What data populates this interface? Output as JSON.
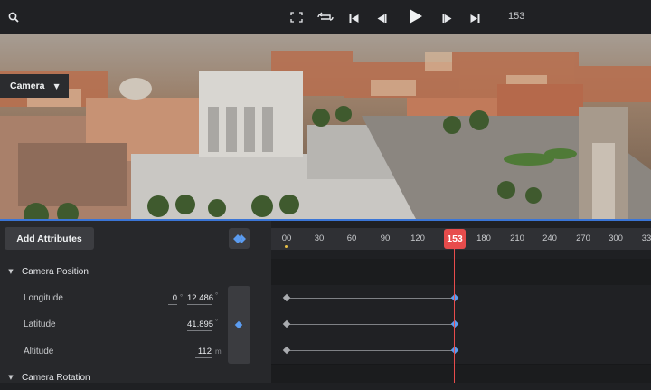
{
  "toolbar": {
    "search_icon": "search-icon",
    "fullscreen_icon": "fullscreen-icon",
    "loop_icon": "loop-icon",
    "skip_start_icon": "skip-to-start-icon",
    "step_back_icon": "step-back-icon",
    "play_icon": "play-icon",
    "step_forward_icon": "step-forward-icon",
    "skip_end_icon": "skip-to-end-icon",
    "frame": "153"
  },
  "viewport": {
    "camera_dropdown": "Camera"
  },
  "panel": {
    "add_attributes": "Add Attributes",
    "sections": [
      {
        "label": "Camera Position",
        "expanded": true
      },
      {
        "label": "Camera Rotation",
        "expanded": true
      }
    ],
    "attributes": [
      {
        "label": "Longitude",
        "value_a": "0",
        "separator": "°",
        "value_b": "12.486",
        "unit": "°"
      },
      {
        "label": "Latitude",
        "value": "41.895",
        "unit": "°"
      },
      {
        "label": "Altitude",
        "value": "112",
        "unit": "m"
      }
    ]
  },
  "timeline": {
    "ticks": [
      "00",
      "30",
      "60",
      "90",
      "120",
      "180",
      "210",
      "240",
      "270",
      "300",
      "33"
    ],
    "current_frame": "153",
    "colors": {
      "playhead": "#e74c4c",
      "keyframe_selected": "#5b9cf0",
      "keyframe": "#a9abaf",
      "accent": "#3a75d6"
    }
  }
}
